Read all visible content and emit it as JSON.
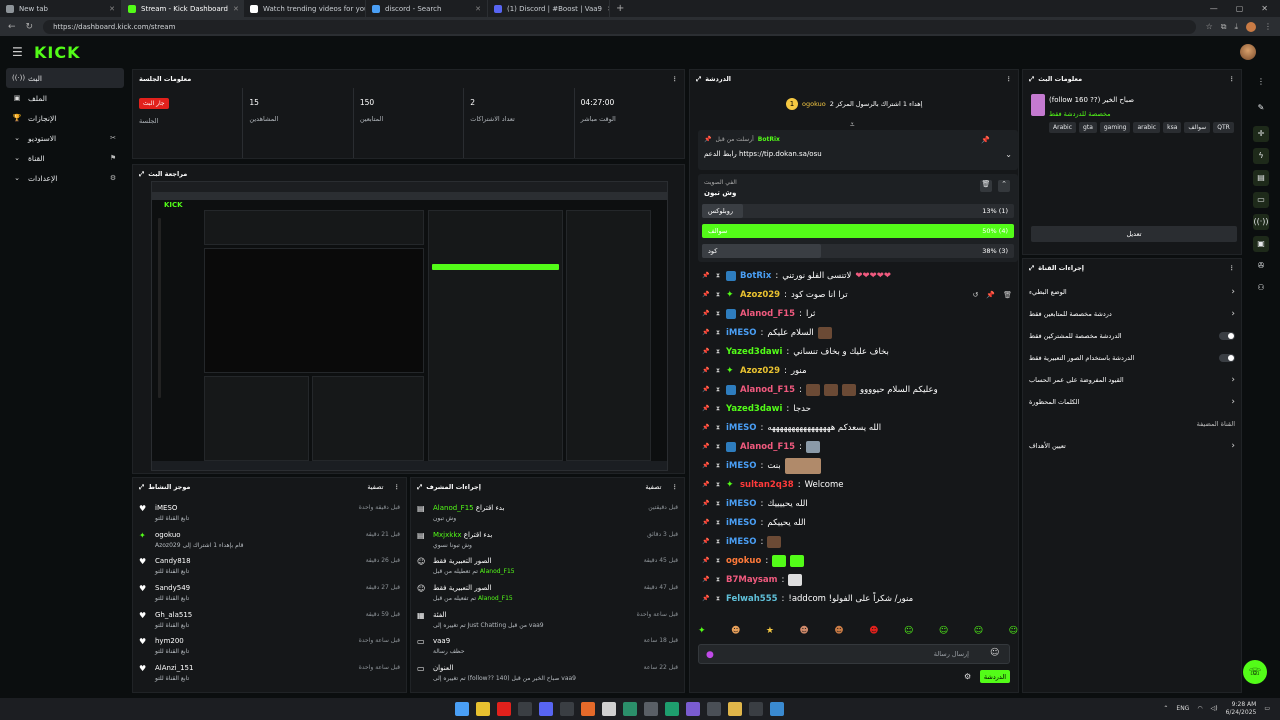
{
  "browser": {
    "tabs": [
      {
        "label": "New tab",
        "favicon_color": "#8e9499"
      },
      {
        "label": "Stream - Kick Dashboard",
        "favicon_color": "#53fc18"
      },
      {
        "label": "Watch trending videos for you | T",
        "favicon_color": "#ffffff"
      },
      {
        "label": "discord - Search",
        "favicon_color": "#4a9ff5"
      },
      {
        "label": "(1) Discord | #Boost | Vaa9",
        "favicon_color": "#5865f2"
      }
    ],
    "url": "https://dashboard.kick.com/stream"
  },
  "header": {
    "logo": "KICK"
  },
  "leftnav": {
    "items": [
      {
        "label": "البث",
        "icon": "live-icon",
        "active": true
      },
      {
        "label": "الملف",
        "icon": "profile-icon"
      },
      {
        "label": "الإنجازات",
        "icon": "trophy-icon"
      },
      {
        "label": "الاستوديو",
        "icon": "studio-icon",
        "expand": true
      },
      {
        "label": "القناة",
        "icon": "channel-icon",
        "expand": true
      },
      {
        "label": "الإعدادات",
        "icon": "settings-icon",
        "expand": true
      }
    ]
  },
  "session": {
    "title": "معلومات الجلسة",
    "stats": [
      {
        "value": "04:27:00",
        "label": "الوقت مباشر"
      },
      {
        "value": "2",
        "label": "تعداد الاشتراكات"
      },
      {
        "value": "150",
        "label": "المتابعين"
      },
      {
        "value": "15",
        "label": "المشاهدين"
      },
      {
        "badge": "جار البث",
        "label": "الجلسة"
      }
    ]
  },
  "preview": {
    "title": "مراجعة البث"
  },
  "activity": {
    "title": "موجز النشاط",
    "filter": "تصفية",
    "rows": [
      {
        "name": "iMESO",
        "sub": "تابع القناة للتو",
        "time": "قبل دقيقة واحدة"
      },
      {
        "name": "ogokuo",
        "sub": "Azoz029 قام بإهداء 1 اشتراك إلى",
        "gift_to": "Azoz029",
        "time": "قبل 21 دقيقة"
      },
      {
        "name": "Candy818",
        "sub": "تابع القناة للتو",
        "time": "قبل 26 دقيقة"
      },
      {
        "name": "Sandy549",
        "sub": "تابع القناة للتو",
        "time": "قبل 27 دقيقة"
      },
      {
        "name": "Gh_ala515",
        "sub": "تابع القناة للتو",
        "time": "قبل 59 دقيقة"
      },
      {
        "name": "hym200",
        "sub": "تابع القناة للتو",
        "time": "قبل ساعة واحدة"
      },
      {
        "name": "AlAnzi_151",
        "sub": "تابع القناة للتو",
        "time": "قبل ساعة واحدة"
      }
    ]
  },
  "modactions": {
    "title": "إجراءات المشرف",
    "filter": "تصفية",
    "rows": [
      {
        "name": "Alanod_F15",
        "action": "بدء اقتراع",
        "sub": "وش تبون",
        "time": "قبل دقيقتين"
      },
      {
        "name": "Mxjxkkx",
        "action": "بدء اقتراع",
        "sub": "وش تبونا نسوي",
        "time": "قبل 3 دقائق"
      },
      {
        "name": "الصور التعبيرية فقط",
        "action": "",
        "sub": "تم تعطيله من قبل",
        "by": "Alanod_F15",
        "time": "قبل 45 دقيقة"
      },
      {
        "name": "الصور التعبيرية فقط",
        "action": "",
        "sub": "تم تفعيله من قبل",
        "by": "Alanod_F15",
        "time": "قبل 47 دقيقة"
      },
      {
        "name": "الفئة",
        "action": "",
        "sub": "تم تغييره إلى Just Chatting من قبل vaa9",
        "by": "vaa9",
        "time": "قبل ساعة واحدة"
      },
      {
        "name": "vaa9",
        "action": "",
        "sub": "حظف رسالة",
        "time": "قبل 18 ساعة"
      },
      {
        "name": "العنوان",
        "action": "",
        "sub": "تم تغييره إلى (follow?? 140) صباح الخير من قبل vaa9",
        "by": "vaa9",
        "time": "قبل 22 ساعة"
      }
    ]
  },
  "chat": {
    "title": "الدردشة",
    "gifter": {
      "name": "ogokuo",
      "count": "1",
      "text": "إهداء 1 اشتراك بالرسول المركز 2"
    },
    "pinned": {
      "by": "BotRix",
      "by_prefix": "أرسلت من قبل",
      "text": "رابط الدعم https://tip.dokan.sa/osu"
    },
    "poll": {
      "title": "الفي الصويت",
      "question": "وش تبون",
      "options": [
        {
          "label": "روبلوكس",
          "percent": 13,
          "votes": "13% (1)"
        },
        {
          "label": "سوالف",
          "percent": 50,
          "votes": "50% (4)"
        },
        {
          "label": "كود",
          "percent": 38,
          "votes": "38% (3)"
        }
      ]
    },
    "messages": [
      {
        "user": "BotRix",
        "color": "blue",
        "text": "لاتنسى الفلو نورتني"
      },
      {
        "user": "Azoz029",
        "color": "yellow",
        "text": "ترا انا صوت كود"
      },
      {
        "user": "Alanod_F15",
        "color": "pink",
        "text": "ثرا"
      },
      {
        "user": "iMESO",
        "color": "blue",
        "text": "السلام عليكم"
      },
      {
        "user": "Yazed3dawi",
        "color": "green",
        "text": "بخاف عليك و بخاف تنساني"
      },
      {
        "user": "Azoz029",
        "color": "yellow",
        "text": "منور"
      },
      {
        "user": "Alanod_F15",
        "color": "pink",
        "text": "وعليكم السلام حيوووو"
      },
      {
        "user": "Yazed3dawi",
        "color": "green",
        "text": "حدجا"
      },
      {
        "user": "iMESO",
        "color": "blue",
        "text": "الله يسعدكم ههههههههههههههههه"
      },
      {
        "user": "Alanod_F15",
        "color": "pink",
        "text": ""
      },
      {
        "user": "iMESO",
        "color": "blue",
        "text": "بنت"
      },
      {
        "user": "sultan2q38",
        "color": "red",
        "text": "Welcome"
      },
      {
        "user": "iMESO",
        "color": "blue",
        "text": "الله يحييييك"
      },
      {
        "user": "iMESO",
        "color": "blue",
        "text": "الله يحييكم"
      },
      {
        "user": "iMESO",
        "color": "blue",
        "text": ""
      },
      {
        "user": "ogokuo",
        "color": "orange",
        "text": ""
      },
      {
        "user": "B7Maysam",
        "color": "pink",
        "text": ""
      },
      {
        "user": "Felwah555",
        "color": "teal",
        "text": "!addcom !منور/ شكراً على الفولو"
      }
    ],
    "input_placeholder": "إرسال رسالة",
    "send_label": "الدردشة"
  },
  "streaminfo": {
    "title": "معلومات البث",
    "stream_title": "(follow 160 ??) صباح الخير",
    "category": "مخصصة للدردشة فقط",
    "tags": [
      "Arabic",
      "gta",
      "gaming",
      "arabic",
      "ksa",
      "سوالف",
      "QTR"
    ],
    "edit_label": "تعديل"
  },
  "quick": {
    "title": "إجراءات القناة",
    "rows": [
      {
        "label": "الوضع البطيء",
        "type": "chevron"
      },
      {
        "label": "دردشة مخصصة للمتابعين فقط",
        "type": "chevron"
      },
      {
        "label": "الدردشة مخصصة للمشتركين فقط",
        "type": "toggle"
      },
      {
        "label": "الدردشة باستخدام الصور التعبيرية فقط",
        "type": "toggle"
      },
      {
        "label": "القيود المفروضة على عمر الحساب",
        "type": "chevron"
      },
      {
        "label": "الكلمات المحظورة",
        "type": "chevron"
      }
    ],
    "section2": "القناة المضيفة",
    "host_row": "تعيين الأهداف"
  },
  "taskbar": {
    "lang": "ENG",
    "time": "9:28 AM",
    "date": "6/24/2025"
  },
  "colors": {
    "accent": "#53fc18",
    "panel": "#151719",
    "bg": "#0b0e0f",
    "live": "#e2211c"
  }
}
